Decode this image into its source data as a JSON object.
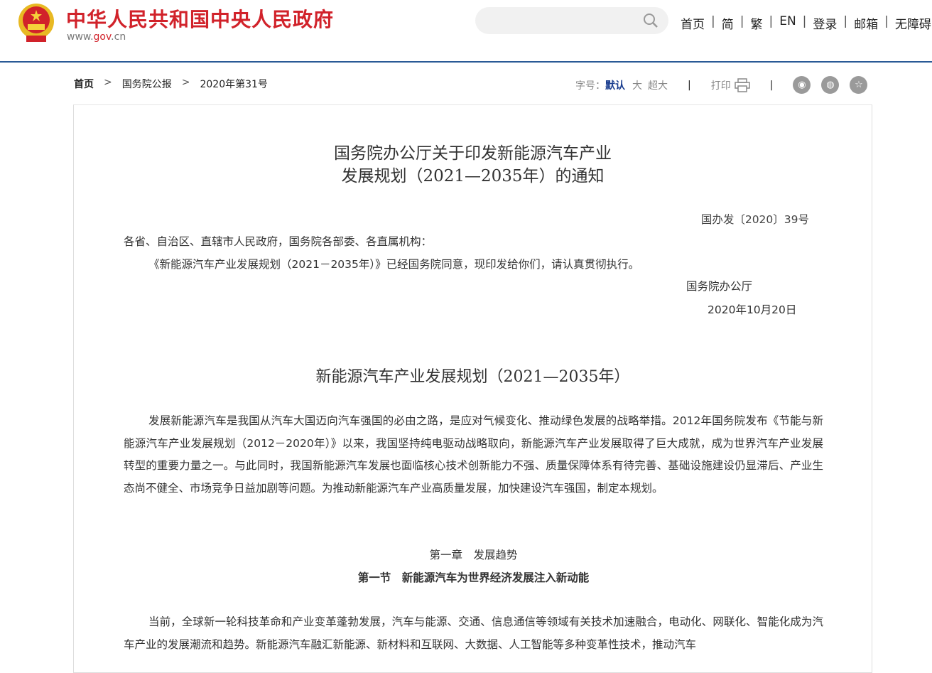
{
  "header": {
    "site_title": "中华人民共和国中央人民政府",
    "site_url_pre": "www.",
    "site_url_mid": "gov",
    "site_url_post": ".cn",
    "search_placeholder": "",
    "nav": [
      "首页",
      "简",
      "繁",
      "EN",
      "登录",
      "邮箱",
      "无障碍"
    ]
  },
  "breadcrumb": [
    "首页",
    "国务院公报",
    "2020年第31号"
  ],
  "tools": {
    "font_label": "字号：",
    "font_default": "默认",
    "font_large": "大",
    "font_xlarge": "超大",
    "print": "打印"
  },
  "doc": {
    "title_line1": "国务院办公厅关于印发新能源汽车产业",
    "title_line2": "发展规划（2021—2035年）的通知",
    "doc_no": "国办发〔2020〕39号",
    "addressee": "各省、自治区、直辖市人民政府，国务院各部委、各直属机构：",
    "body": "《新能源汽车产业发展规划（2021－2035年）》已经国务院同意，现印发给你们，请认真贯彻执行。",
    "issuer": "国务院办公厅",
    "date": "2020年10月20日",
    "plan_title": "新能源汽车产业发展规划（2021—2035年）",
    "para1": "发展新能源汽车是我国从汽车大国迈向汽车强国的必由之路，是应对气候变化、推动绿色发展的战略举措。2012年国务院发布《节能与新能源汽车产业发展规划（2012－2020年）》以来，我国坚持纯电驱动战略取向，新能源汽车产业发展取得了巨大成就，成为世界汽车产业发展转型的重要力量之一。与此同时，我国新能源汽车发展也面临核心技术创新能力不强、质量保障体系有待完善、基础设施建设仍显滞后、产业生态尚不健全、市场竞争日益加剧等问题。为推动新能源汽车产业高质量发展，加快建设汽车强国，制定本规划。",
    "chapter": "第一章　发展趋势",
    "section": "第一节　新能源汽车为世界经济发展注入新动能",
    "para2": "当前，全球新一轮科技革命和产业变革蓬勃发展，汽车与能源、交通、信息通信等领域有关技术加速融合，电动化、网联化、智能化成为汽车产业的发展潮流和趋势。新能源汽车融汇新能源、新材料和互联网、大数据、人工智能等多种变革性技术，推动汽车"
  }
}
